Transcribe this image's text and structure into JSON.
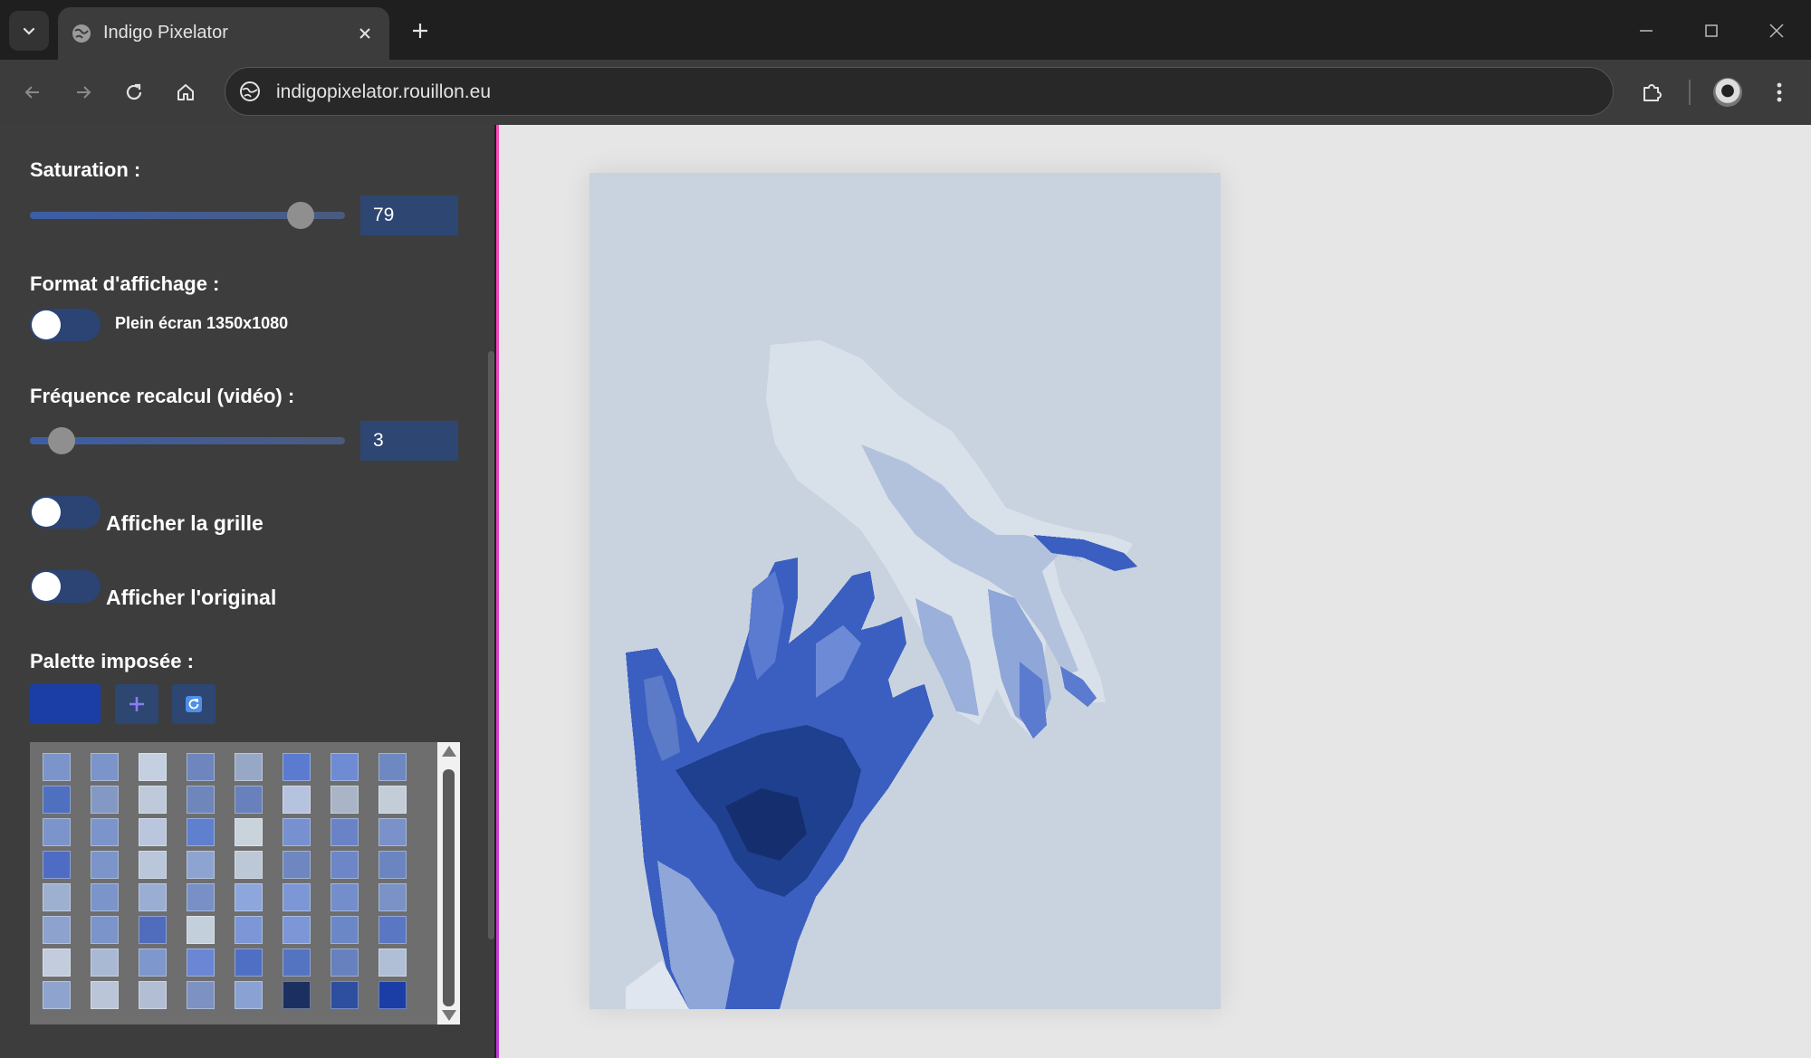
{
  "browser": {
    "tab_title": "Indigo Pixelator",
    "url": "indigopixelator.rouillon.eu"
  },
  "controls": {
    "saturation_label": "Saturation :",
    "saturation_value": "79",
    "saturation_level": 0.86,
    "format_label": "Format d'affichage :",
    "format_toggle_label": "Plein écran 1350x1080",
    "format_toggle_on": false,
    "frequency_label": "Fréquence recalcul (vidéo) :",
    "frequency_value": "3",
    "frequency_level": 0.1,
    "grid_label": "Afficher la grille",
    "grid_on": false,
    "original_label": "Afficher l'original",
    "original_on": false,
    "palette_label": "Palette imposée :",
    "palette_selected_color": "#1a3ea6",
    "add_icon": "plus-icon",
    "refresh_icon": "refresh-icon"
  },
  "palette_colors": [
    "#7b94c9",
    "#7b94c9",
    "#c4cfe0",
    "#6e86bd",
    "#97a8c7",
    "#5a7bd0",
    "#6f8bd4",
    "#6e88c2",
    "#4f6fbf",
    "#8399c4",
    "#bec9d9",
    "#6f86bb",
    "#6880bb",
    "#b5c3de",
    "#a9b5c6",
    "#c2cdd8",
    "#7b94c9",
    "#7b94c9",
    "#b9c6dd",
    "#5f7fcf",
    "#c9d3dc",
    "#7690d0",
    "#6983c6",
    "#7a91c9",
    "#4e6cc4",
    "#7b94c9",
    "#bac6da",
    "#8ea4d0",
    "#bdc8d6",
    "#6f87c0",
    "#6c86c7",
    "#6b85c1",
    "#9eb0cf",
    "#7b94c9",
    "#9aadd2",
    "#7890c6",
    "#8da6dc",
    "#7d97d6",
    "#748ecb",
    "#7a92c5",
    "#8da2cd",
    "#7b94c9",
    "#4f6cbd",
    "#c4cfdc",
    "#7c96d6",
    "#7d96d6",
    "#6c87c6",
    "#5a77c3",
    "#c2ccdc",
    "#a9b9d3",
    "#7e97cd",
    "#6a86d4",
    "#4e6fc3",
    "#5473c0",
    "#6681bd",
    "#b0bfd6",
    "#8ea4cf",
    "#bac5d8",
    "#b2bed3",
    "#7d92c2",
    "#8aa1d3",
    "#1c2f61",
    "#2e4f9f",
    "#1a3ea6"
  ],
  "artwork": {
    "background": "#c9d3df",
    "dark_blue": "#1f3f8f",
    "mid_blue": "#3b5fc0",
    "light_blue": "#8ea6d8",
    "pale": "#dfe6ef"
  }
}
